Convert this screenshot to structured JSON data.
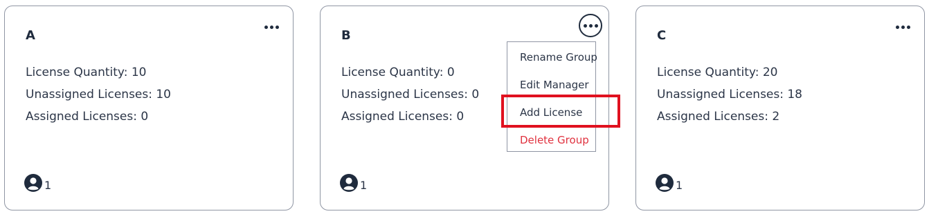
{
  "groups": [
    {
      "name": "A",
      "license_quantity": "License Quantity: 10",
      "unassigned_licenses": "Unassigned Licenses: 10",
      "assigned_licenses": "Assigned Licenses: 0",
      "member_count": "1"
    },
    {
      "name": "B",
      "license_quantity": "License Quantity: 0",
      "unassigned_licenses": "Unassigned Licenses: 0",
      "assigned_licenses": "Assigned Licenses: 0",
      "member_count": "1"
    },
    {
      "name": "C",
      "license_quantity": "License Quantity: 20",
      "unassigned_licenses": "Unassigned Licenses: 18",
      "assigned_licenses": "Assigned Licenses: 2",
      "member_count": "1"
    }
  ],
  "menu": {
    "items": [
      {
        "label": "Rename Group"
      },
      {
        "label": "Edit Manager"
      },
      {
        "label": "Add License"
      },
      {
        "label": "Delete Group"
      }
    ],
    "highlighted_item": "Add License"
  },
  "colors": {
    "text": "#1f2b3d",
    "border": "#8f95a3",
    "danger": "#e0313e",
    "highlight": "#e0111f"
  },
  "icons": {
    "more": "more-horizontal-icon",
    "member": "user-avatar-icon"
  }
}
